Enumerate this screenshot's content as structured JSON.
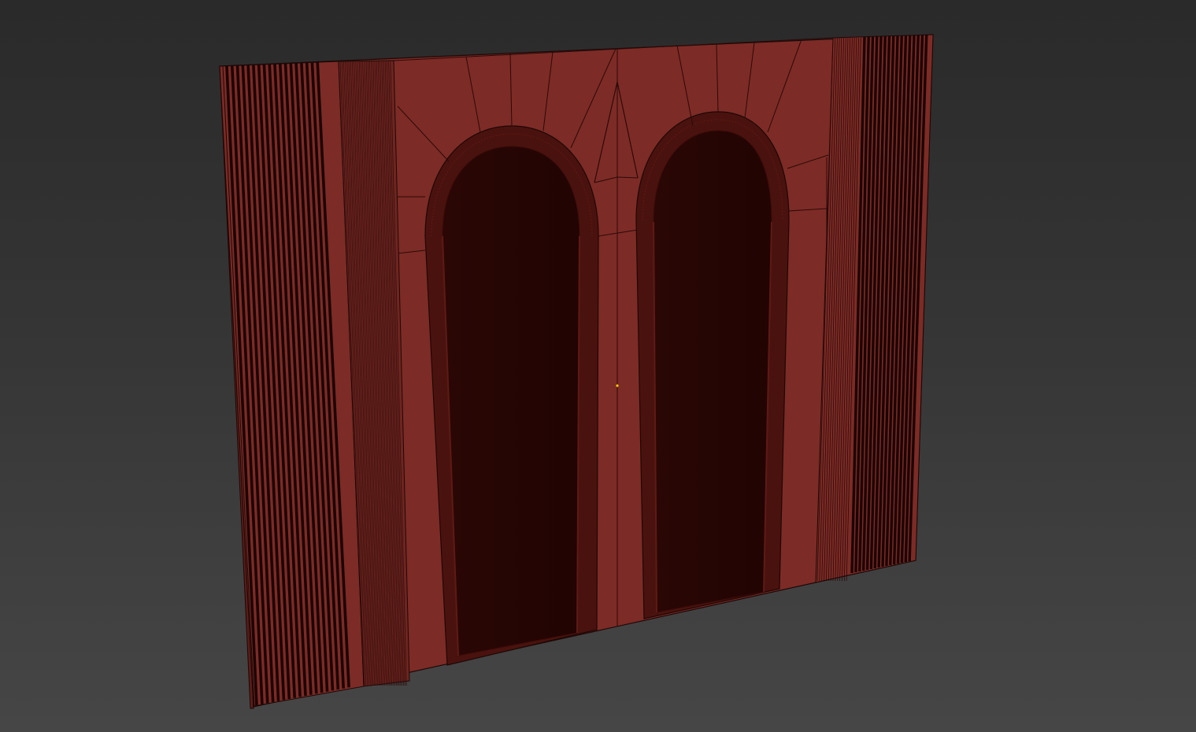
{
  "viewport": {
    "label": "",
    "view_mode": "perspective",
    "shading": "edged-faces"
  },
  "scene": {
    "object_name": "",
    "object_type": "arched wall panel with two doorways",
    "colors": {
      "background_top": "#2a2a2a",
      "background_bottom": "#464646",
      "wall_face": "#7d2b26",
      "wall_edge": "#5a1c18",
      "recess": "#260604",
      "wire": "#1c0806",
      "pivot_marker": "#ffcc00"
    },
    "elements": [
      {
        "name": "left-fluted-pilaster"
      },
      {
        "name": "right-fluted-pilaster"
      },
      {
        "name": "left-arched-doorway"
      },
      {
        "name": "right-arched-doorway"
      },
      {
        "name": "arch-voussoir-segments"
      }
    ]
  }
}
